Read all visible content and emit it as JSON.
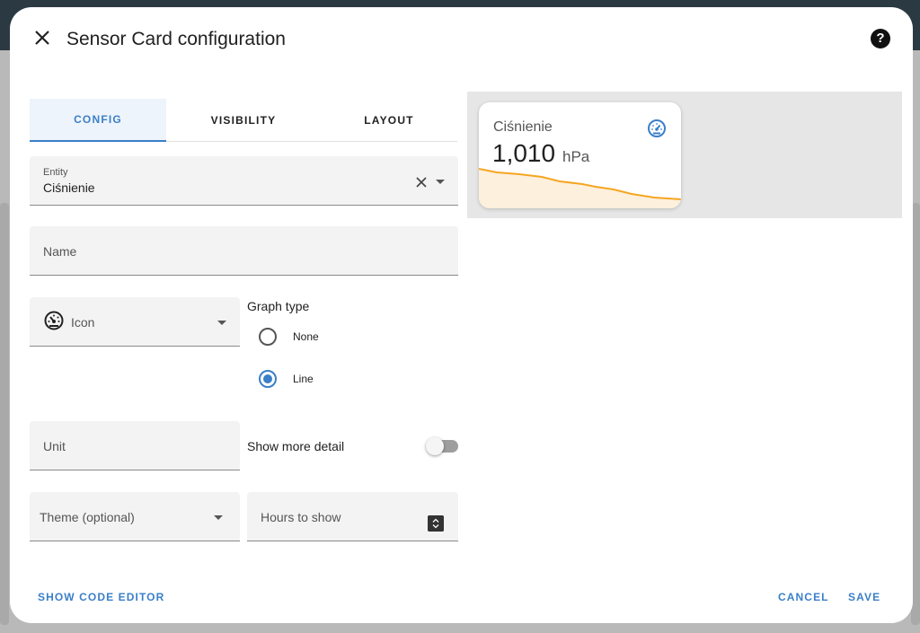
{
  "dialog": {
    "title": "Sensor Card configuration",
    "help_label": "?"
  },
  "tabs": [
    {
      "label": "CONFIG",
      "active": true
    },
    {
      "label": "VISIBILITY",
      "active": false
    },
    {
      "label": "LAYOUT",
      "active": false
    }
  ],
  "fields": {
    "entity": {
      "label": "Entity",
      "value": "Ciśnienie"
    },
    "name": {
      "placeholder": "Name"
    },
    "icon": {
      "placeholder": "Icon",
      "icon": "gauge-icon"
    },
    "unit": {
      "placeholder": "Unit"
    },
    "theme": {
      "placeholder": "Theme (optional)"
    },
    "hours": {
      "placeholder": "Hours to show"
    }
  },
  "graph_type": {
    "label": "Graph type",
    "options": [
      {
        "label": "None",
        "selected": false
      },
      {
        "label": "Line",
        "selected": true
      }
    ]
  },
  "show_more_detail": {
    "label": "Show more detail",
    "on": false
  },
  "preview": {
    "name": "Ciśnienie",
    "value": "1,010",
    "unit": "hPa",
    "icon": "gauge-icon",
    "graph_color": "#f5a623"
  },
  "footer": {
    "code_editor_label": "SHOW CODE EDITOR",
    "cancel_label": "CANCEL",
    "save_label": "SAVE"
  },
  "colors": {
    "accent": "#3a7fc8",
    "graph": "#f5a623"
  }
}
